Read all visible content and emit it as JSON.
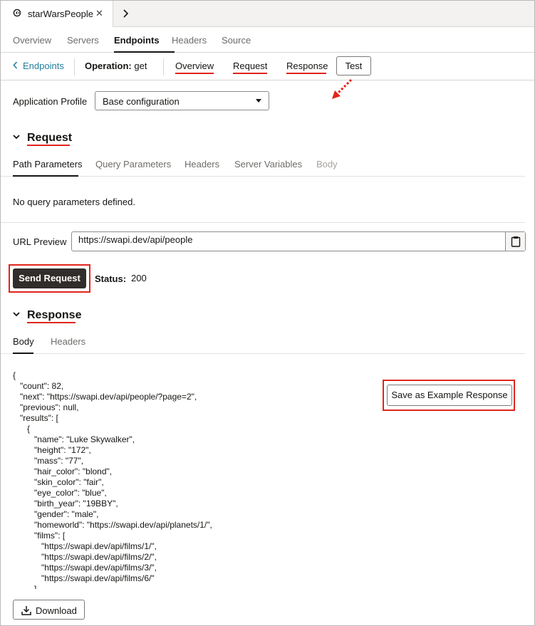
{
  "file_tab": {
    "name": "starWarsPeople",
    "close_glyph": "✕",
    "icon": "connection-icon"
  },
  "top_tabs": [
    {
      "label": "Overview"
    },
    {
      "label": "Servers"
    },
    {
      "label": "Endpoints",
      "active": true
    },
    {
      "label": "Headers"
    },
    {
      "label": "Source"
    }
  ],
  "endpoint_bar": {
    "back_label": "Endpoints",
    "operation_label": "Operation:",
    "operation_value": "get",
    "links": [
      {
        "label": "Overview"
      },
      {
        "label": "Request"
      },
      {
        "label": "Response"
      }
    ],
    "test_label": "Test"
  },
  "app_profile": {
    "label": "Application Profile",
    "value": "Base configuration"
  },
  "request": {
    "title": "Request",
    "tabs": [
      {
        "label": "Path Parameters",
        "active": true
      },
      {
        "label": "Query Parameters"
      },
      {
        "label": "Headers"
      },
      {
        "label": "Server Variables"
      },
      {
        "label": "Body",
        "disabled": true
      }
    ],
    "empty_message": "No query parameters defined.",
    "url_label": "URL Preview",
    "url_value": "https://swapi.dev/api/people",
    "send_label": "Send Request",
    "status_label": "Status:",
    "status_value": "200"
  },
  "response": {
    "title": "Response",
    "tabs": [
      {
        "label": "Body",
        "active": true
      },
      {
        "label": "Headers"
      }
    ],
    "body_lines": [
      "{",
      "   \"count\": 82,",
      "   \"next\": \"https://swapi.dev/api/people/?page=2\",",
      "   \"previous\": null,",
      "   \"results\": [",
      "      {",
      "         \"name\": \"Luke Skywalker\",",
      "         \"height\": \"172\",",
      "         \"mass\": \"77\",",
      "         \"hair_color\": \"blond\",",
      "         \"skin_color\": \"fair\",",
      "         \"eye_color\": \"blue\",",
      "         \"birth_year\": \"19BBY\",",
      "         \"gender\": \"male\",",
      "         \"homeworld\": \"https://swapi.dev/api/planets/1/\",",
      "         \"films\": [",
      "            \"https://swapi.dev/api/films/1/\",",
      "            \"https://swapi.dev/api/films/2/\",",
      "            \"https://swapi.dev/api/films/3/\",",
      "            \"https://swapi.dev/api/films/6/\"",
      "         ],"
    ],
    "save_label": "Save as Example Response",
    "download_label": "Download"
  },
  "colors": {
    "accent_red": "#e1251b",
    "link_blue": "#227e9e",
    "dark_button": "#312d2a"
  }
}
